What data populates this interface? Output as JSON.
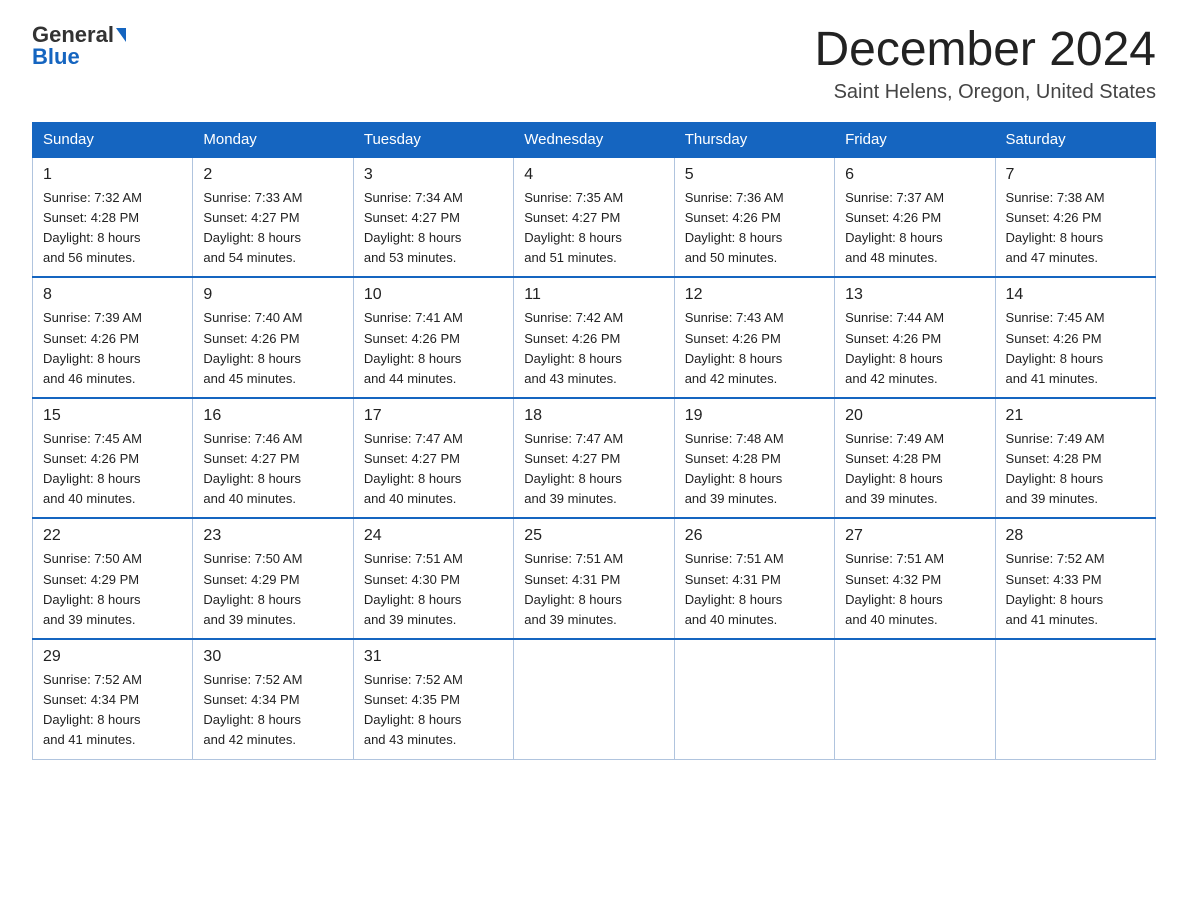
{
  "logo": {
    "general": "General",
    "blue": "Blue"
  },
  "title": "December 2024",
  "location": "Saint Helens, Oregon, United States",
  "days_of_week": [
    "Sunday",
    "Monday",
    "Tuesday",
    "Wednesday",
    "Thursday",
    "Friday",
    "Saturday"
  ],
  "weeks": [
    [
      {
        "day": "1",
        "sunrise": "7:32 AM",
        "sunset": "4:28 PM",
        "daylight": "8 hours and 56 minutes."
      },
      {
        "day": "2",
        "sunrise": "7:33 AM",
        "sunset": "4:27 PM",
        "daylight": "8 hours and 54 minutes."
      },
      {
        "day": "3",
        "sunrise": "7:34 AM",
        "sunset": "4:27 PM",
        "daylight": "8 hours and 53 minutes."
      },
      {
        "day": "4",
        "sunrise": "7:35 AM",
        "sunset": "4:27 PM",
        "daylight": "8 hours and 51 minutes."
      },
      {
        "day": "5",
        "sunrise": "7:36 AM",
        "sunset": "4:26 PM",
        "daylight": "8 hours and 50 minutes."
      },
      {
        "day": "6",
        "sunrise": "7:37 AM",
        "sunset": "4:26 PM",
        "daylight": "8 hours and 48 minutes."
      },
      {
        "day": "7",
        "sunrise": "7:38 AM",
        "sunset": "4:26 PM",
        "daylight": "8 hours and 47 minutes."
      }
    ],
    [
      {
        "day": "8",
        "sunrise": "7:39 AM",
        "sunset": "4:26 PM",
        "daylight": "8 hours and 46 minutes."
      },
      {
        "day": "9",
        "sunrise": "7:40 AM",
        "sunset": "4:26 PM",
        "daylight": "8 hours and 45 minutes."
      },
      {
        "day": "10",
        "sunrise": "7:41 AM",
        "sunset": "4:26 PM",
        "daylight": "8 hours and 44 minutes."
      },
      {
        "day": "11",
        "sunrise": "7:42 AM",
        "sunset": "4:26 PM",
        "daylight": "8 hours and 43 minutes."
      },
      {
        "day": "12",
        "sunrise": "7:43 AM",
        "sunset": "4:26 PM",
        "daylight": "8 hours and 42 minutes."
      },
      {
        "day": "13",
        "sunrise": "7:44 AM",
        "sunset": "4:26 PM",
        "daylight": "8 hours and 42 minutes."
      },
      {
        "day": "14",
        "sunrise": "7:45 AM",
        "sunset": "4:26 PM",
        "daylight": "8 hours and 41 minutes."
      }
    ],
    [
      {
        "day": "15",
        "sunrise": "7:45 AM",
        "sunset": "4:26 PM",
        "daylight": "8 hours and 40 minutes."
      },
      {
        "day": "16",
        "sunrise": "7:46 AM",
        "sunset": "4:27 PM",
        "daylight": "8 hours and 40 minutes."
      },
      {
        "day": "17",
        "sunrise": "7:47 AM",
        "sunset": "4:27 PM",
        "daylight": "8 hours and 40 minutes."
      },
      {
        "day": "18",
        "sunrise": "7:47 AM",
        "sunset": "4:27 PM",
        "daylight": "8 hours and 39 minutes."
      },
      {
        "day": "19",
        "sunrise": "7:48 AM",
        "sunset": "4:28 PM",
        "daylight": "8 hours and 39 minutes."
      },
      {
        "day": "20",
        "sunrise": "7:49 AM",
        "sunset": "4:28 PM",
        "daylight": "8 hours and 39 minutes."
      },
      {
        "day": "21",
        "sunrise": "7:49 AM",
        "sunset": "4:28 PM",
        "daylight": "8 hours and 39 minutes."
      }
    ],
    [
      {
        "day": "22",
        "sunrise": "7:50 AM",
        "sunset": "4:29 PM",
        "daylight": "8 hours and 39 minutes."
      },
      {
        "day": "23",
        "sunrise": "7:50 AM",
        "sunset": "4:29 PM",
        "daylight": "8 hours and 39 minutes."
      },
      {
        "day": "24",
        "sunrise": "7:51 AM",
        "sunset": "4:30 PM",
        "daylight": "8 hours and 39 minutes."
      },
      {
        "day": "25",
        "sunrise": "7:51 AM",
        "sunset": "4:31 PM",
        "daylight": "8 hours and 39 minutes."
      },
      {
        "day": "26",
        "sunrise": "7:51 AM",
        "sunset": "4:31 PM",
        "daylight": "8 hours and 40 minutes."
      },
      {
        "day": "27",
        "sunrise": "7:51 AM",
        "sunset": "4:32 PM",
        "daylight": "8 hours and 40 minutes."
      },
      {
        "day": "28",
        "sunrise": "7:52 AM",
        "sunset": "4:33 PM",
        "daylight": "8 hours and 41 minutes."
      }
    ],
    [
      {
        "day": "29",
        "sunrise": "7:52 AM",
        "sunset": "4:34 PM",
        "daylight": "8 hours and 41 minutes."
      },
      {
        "day": "30",
        "sunrise": "7:52 AM",
        "sunset": "4:34 PM",
        "daylight": "8 hours and 42 minutes."
      },
      {
        "day": "31",
        "sunrise": "7:52 AM",
        "sunset": "4:35 PM",
        "daylight": "8 hours and 43 minutes."
      },
      null,
      null,
      null,
      null
    ]
  ],
  "labels": {
    "sunrise": "Sunrise:",
    "sunset": "Sunset:",
    "daylight": "Daylight:"
  }
}
